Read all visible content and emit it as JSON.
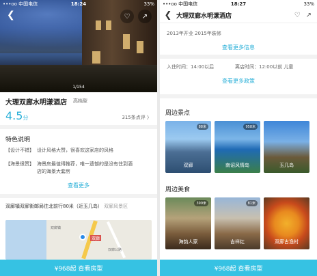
{
  "left": {
    "status": {
      "carrier": "•••oo 中国电信",
      "time": "18:24",
      "battery": "33%"
    },
    "photo_counter": "1/154",
    "hotel": {
      "name": "大理双廊水明漾酒店",
      "grade": "高档型",
      "score": "4.5",
      "score_unit": "分",
      "reviews": "315条点评 〉"
    },
    "features": {
      "title": "特色说明",
      "rows": [
        {
          "tag": "【设计不错】",
          "text": "设计风格大赞，很喜欢这家店的风格"
        },
        {
          "tag": "【海景很赞】",
          "text": "海景房最值得推荐，唯一遗憾的是没有住到酒店的海景大套房"
        }
      ],
      "more": "查看更多"
    },
    "address": {
      "line": "双廊镇双廊街邮局往北前行80米（近玉几岛）",
      "area": "双廊风景区"
    },
    "map": {
      "pin_label": "双廊",
      "labels": [
        "双廊镇",
        "双廊公路"
      ]
    },
    "cta": "¥968起  查看房型"
  },
  "right": {
    "status": {
      "carrier": "•••oo 中国电信",
      "time": "18:27",
      "battery": "33%"
    },
    "nav": {
      "title": "大理双廊水明漾酒店"
    },
    "opened": "2013年开业 2015年装修",
    "more_info": "查看更多信息",
    "checkin": "入住时间：14:00以后",
    "checkout": "离店时间：12:00以前 儿童",
    "more_policy": "查看更多政策",
    "scenic": {
      "title": "周边景点",
      "items": [
        {
          "name": "双廊",
          "dist": "88米"
        },
        {
          "name": "南诏风情岛",
          "dist": "958米"
        },
        {
          "name": "玉几岛",
          "dist": ""
        }
      ]
    },
    "food": {
      "title": "周边美食",
      "items": [
        {
          "name": "海韵人家",
          "dist": "399米"
        },
        {
          "name": "吉祥红",
          "dist": "81米"
        },
        {
          "name": "双廊古渔村",
          "dist": ""
        }
      ]
    },
    "cta": "¥968起  查看房型"
  }
}
